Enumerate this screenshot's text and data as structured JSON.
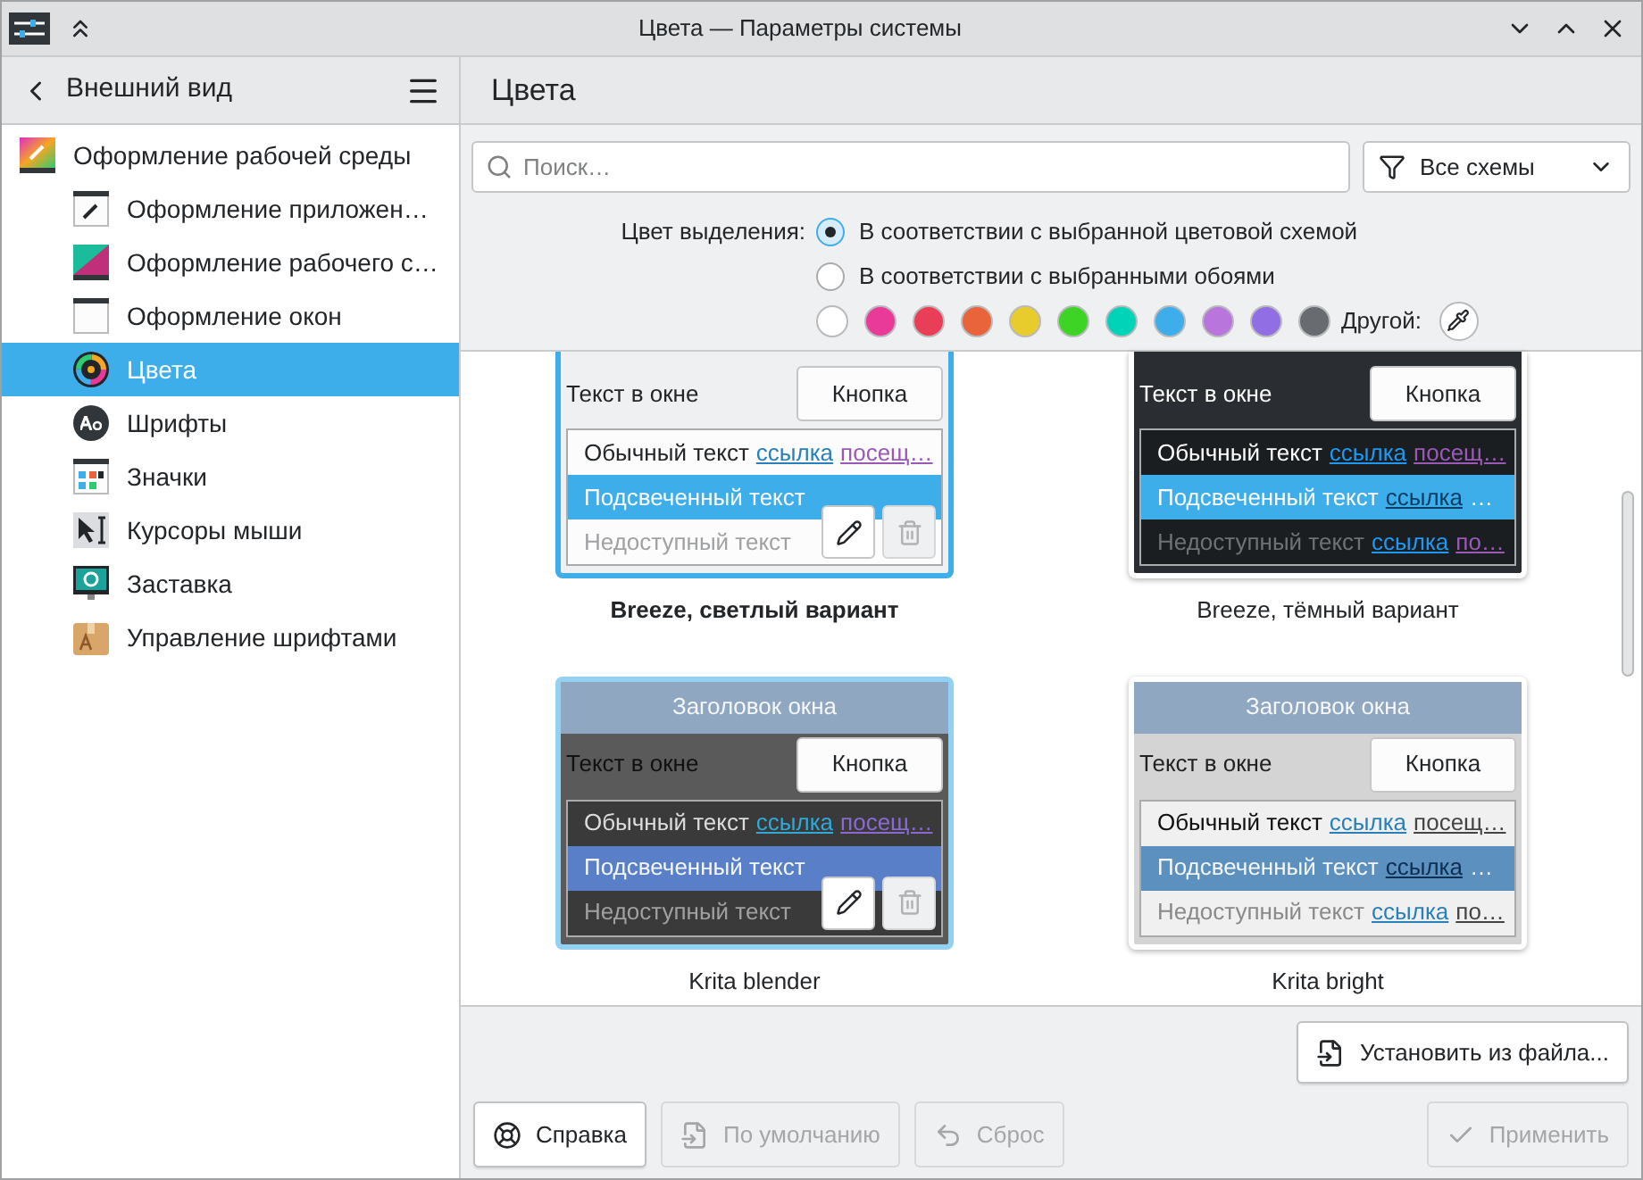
{
  "window": {
    "title": "Цвета — Параметры системы"
  },
  "sidebar": {
    "title": "Внешний вид",
    "items": [
      {
        "label": "Оформление рабочей среды",
        "selected": false,
        "children": [
          {
            "label": "Оформление приложен…",
            "selected": false
          },
          {
            "label": "Оформление рабочего с…",
            "selected": false
          },
          {
            "label": "Оформление окон",
            "selected": false
          },
          {
            "label": "Цвета",
            "selected": true
          },
          {
            "label": "Шрифты",
            "selected": false
          },
          {
            "label": "Значки",
            "selected": false
          },
          {
            "label": "Курсоры мыши",
            "selected": false
          },
          {
            "label": "Заставка",
            "selected": false
          },
          {
            "label": "Управление шрифтами",
            "selected": false
          }
        ]
      }
    ]
  },
  "page": {
    "title": "Цвета"
  },
  "search": {
    "placeholder": "Поиск…"
  },
  "filter": {
    "value": "Все схемы"
  },
  "accent": {
    "label": "Цвет выделения:",
    "options": [
      {
        "label": "В соответствии с выбранной цветовой схемой",
        "selected": true
      },
      {
        "label": "В соответствии с выбранными обоями",
        "selected": false
      }
    ],
    "colors": [
      {
        "color": "#ffffff",
        "selected": false
      },
      {
        "color": "#e93a9a",
        "selected": false
      },
      {
        "color": "#e93d58",
        "selected": false
      },
      {
        "color": "#e9643a",
        "selected": false
      },
      {
        "color": "#e8cb2d",
        "selected": false
      },
      {
        "color": "#3dd425",
        "selected": false
      },
      {
        "color": "#00d3b8",
        "selected": false
      },
      {
        "color": "#3daee9",
        "selected": false
      },
      {
        "color": "#b875dc",
        "selected": false
      },
      {
        "color": "#926ee4",
        "selected": false
      },
      {
        "color": "#686b6f",
        "selected": false
      }
    ],
    "custom_label": "Другой:"
  },
  "schemes": [
    {
      "name": "Breeze, светлый вариант",
      "kind": "light",
      "selected": true,
      "hovered": false,
      "window_text": "Текст в окне",
      "button": "Кнопка",
      "rows": [
        {
          "kind": "normal",
          "segments": [
            {
              "kind": "plain",
              "text": "Обычный текст"
            },
            {
              "kind": "link",
              "text": "ссылка"
            },
            {
              "kind": "visited",
              "text": "посещ…"
            }
          ]
        },
        {
          "kind": "highlighted",
          "segments": [
            {
              "kind": "plain",
              "text": "Подсвеченный текст"
            }
          ]
        },
        {
          "kind": "disabled",
          "segments": [
            {
              "kind": "plain",
              "text": "Недоступный текст"
            }
          ]
        }
      ]
    },
    {
      "name": "Breeze, тёмный вариант",
      "kind": "dark",
      "selected": false,
      "hovered": false,
      "window_text": "Текст в окне",
      "button": "Кнопка",
      "rows": [
        {
          "kind": "normal",
          "segments": [
            {
              "kind": "plain",
              "text": "Обычный текст"
            },
            {
              "kind": "link",
              "text": "ссылка"
            },
            {
              "kind": "visited",
              "text": "посещ…"
            }
          ]
        },
        {
          "kind": "highlighted",
          "segments": [
            {
              "kind": "plain",
              "text": "Подсвеченный текст"
            },
            {
              "kind": "link",
              "text": "ссылка"
            },
            {
              "kind": "plain",
              "text": "…"
            }
          ]
        },
        {
          "kind": "disabled",
          "segments": [
            {
              "kind": "plain",
              "text": "Недоступный текст"
            },
            {
              "kind": "link",
              "text": "ссылка"
            },
            {
              "kind": "visited",
              "text": "по…"
            }
          ]
        }
      ]
    },
    {
      "name": "Krita blender",
      "kind": "blender",
      "selected": false,
      "hovered": true,
      "title": "Заголовок окна",
      "window_text": "Текст в окне",
      "button": "Кнопка",
      "rows": [
        {
          "kind": "normal",
          "segments": [
            {
              "kind": "plain",
              "text": "Обычный текст"
            },
            {
              "kind": "link",
              "text": "ссылка"
            },
            {
              "kind": "visited",
              "text": "посещ…"
            }
          ]
        },
        {
          "kind": "highlighted",
          "segments": [
            {
              "kind": "plain",
              "text": "Подсвеченный текст"
            }
          ]
        },
        {
          "kind": "disabled",
          "segments": [
            {
              "kind": "plain",
              "text": "Недоступный текст"
            }
          ]
        }
      ]
    },
    {
      "name": "Krita bright",
      "kind": "bright",
      "selected": false,
      "hovered": false,
      "title": "Заголовок окна",
      "window_text": "Текст в окне",
      "button": "Кнопка",
      "rows": [
        {
          "kind": "normal",
          "segments": [
            {
              "kind": "plain",
              "text": "Обычный текст"
            },
            {
              "kind": "link",
              "text": "ссылка"
            },
            {
              "kind": "visited",
              "text": "посещ…"
            }
          ]
        },
        {
          "kind": "highlighted",
          "segments": [
            {
              "kind": "plain",
              "text": "Подсвеченный текст"
            },
            {
              "kind": "link",
              "text": "ссылка"
            },
            {
              "kind": "plain",
              "text": "…"
            }
          ]
        },
        {
          "kind": "disabled",
          "segments": [
            {
              "kind": "plain",
              "text": "Недоступный текст"
            },
            {
              "kind": "link",
              "text": "ссылка"
            },
            {
              "kind": "visited",
              "text": "по…"
            }
          ]
        }
      ]
    }
  ],
  "install_button": "Установить из файла...",
  "buttons": [
    {
      "label": "Справка",
      "disabled": false
    },
    {
      "label": "По умолчанию",
      "disabled": true
    },
    {
      "label": "Сброс",
      "disabled": true
    },
    {
      "label": "Применить",
      "disabled": true
    }
  ]
}
